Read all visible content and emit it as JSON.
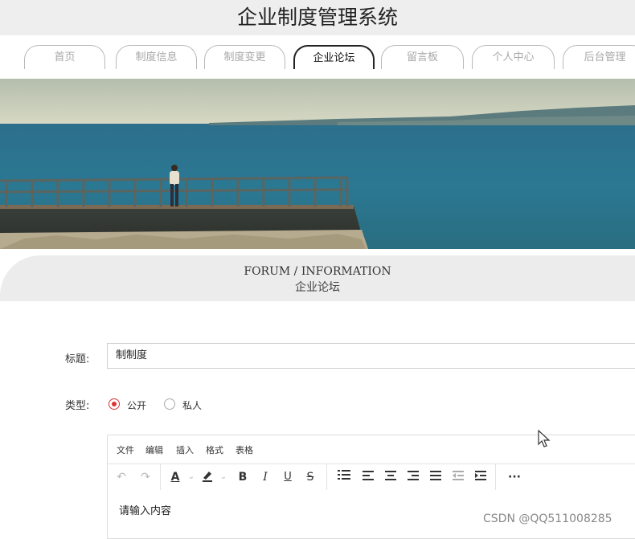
{
  "app": {
    "title": "企业制度管理系统"
  },
  "nav": {
    "tabs": [
      {
        "label": "首页"
      },
      {
        "label": "制度信息"
      },
      {
        "label": "制度变更"
      },
      {
        "label": "企业论坛",
        "active": true
      },
      {
        "label": "留言板"
      },
      {
        "label": "个人中心"
      },
      {
        "label": "后台管理"
      }
    ]
  },
  "section": {
    "en": "FORUM / INFORMATION",
    "zh": "企业论坛"
  },
  "form": {
    "title_label": "标题:",
    "title_value": "制制度",
    "type_label": "类型:",
    "type_options": [
      {
        "label": "公开",
        "selected": true
      },
      {
        "label": "私人",
        "selected": false
      }
    ]
  },
  "editor": {
    "menus": [
      "文件",
      "编辑",
      "插入",
      "格式",
      "表格"
    ],
    "toolbar_icons": [
      "undo-icon",
      "redo-icon",
      "text-color-icon",
      "highlight-color-icon",
      "bold-icon",
      "italic-icon",
      "underline-icon",
      "strikethrough-icon",
      "bullet-list-icon",
      "align-left-icon",
      "align-center-icon",
      "align-right-icon",
      "align-justify-icon",
      "outdent-icon",
      "indent-icon",
      "more-icon"
    ],
    "toolbar_glyphs": {
      "bold": "B",
      "italic": "I",
      "underline": "U",
      "strike": "S",
      "more": "···",
      "text_color": "A"
    },
    "placeholder": "请输入内容"
  },
  "watermark": "CSDN @QQ511008285",
  "colors": {
    "radio_selected": "#dd3333",
    "title_bg": "#eeeeee",
    "section_bg": "#ececec"
  }
}
